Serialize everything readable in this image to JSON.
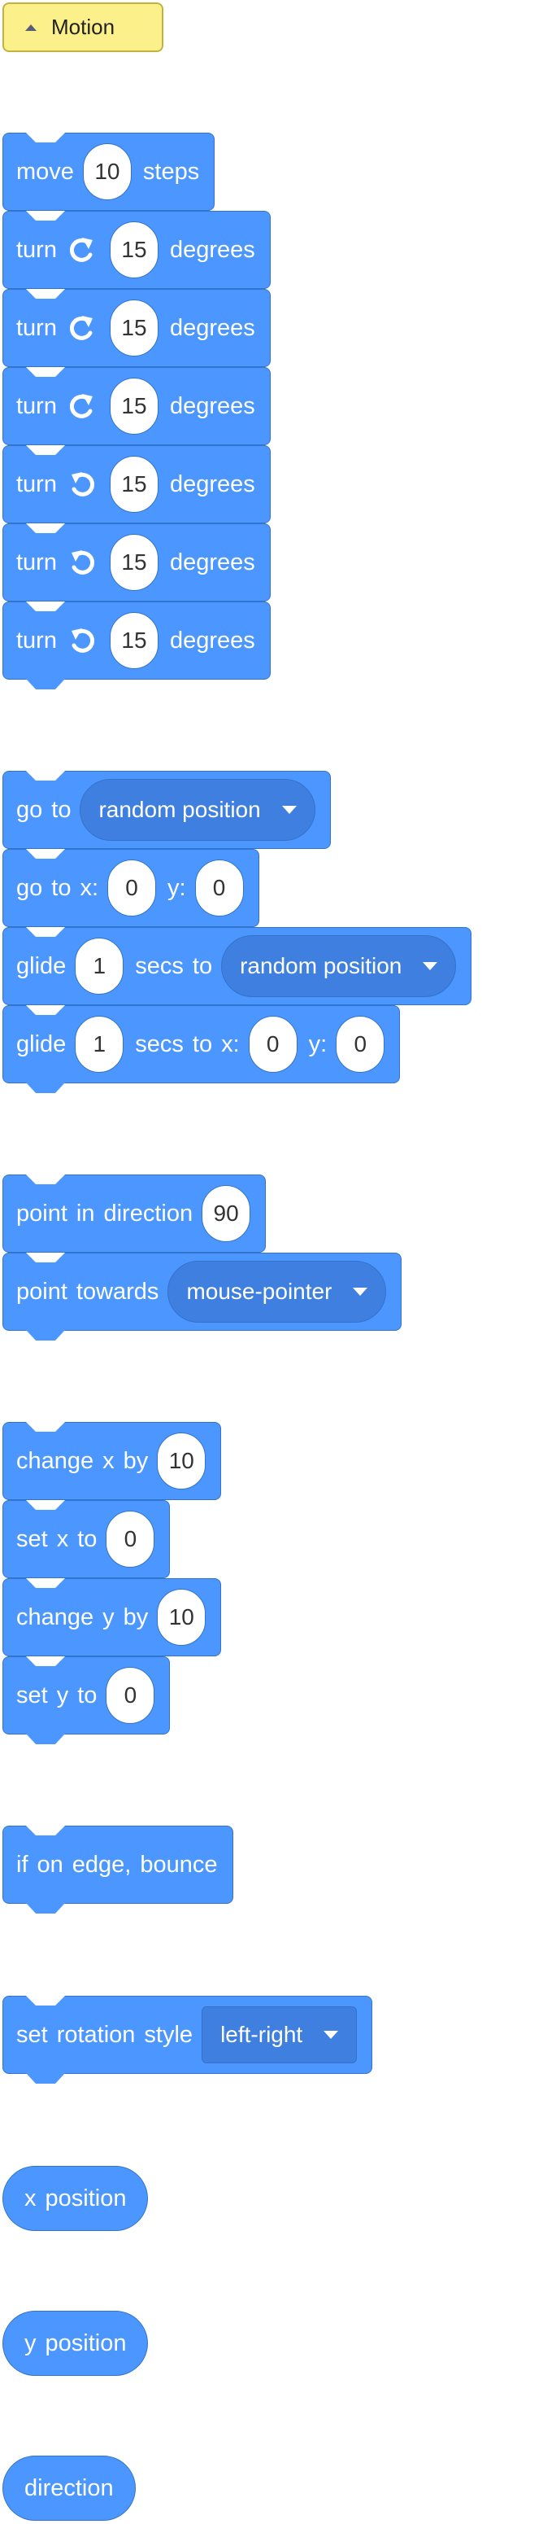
{
  "category": {
    "label": "Motion"
  },
  "blocks": {
    "move": {
      "w1": "move",
      "steps": "10",
      "w2": "steps"
    },
    "turn_cw_1": {
      "w1": "turn",
      "degrees": "15",
      "w2": "degrees"
    },
    "turn_cw_2": {
      "w1": "turn",
      "degrees": "15",
      "w2": "degrees"
    },
    "turn_cw_3": {
      "w1": "turn",
      "degrees": "15",
      "w2": "degrees"
    },
    "turn_ccw_1": {
      "w1": "turn",
      "degrees": "15",
      "w2": "degrees"
    },
    "turn_ccw_2": {
      "w1": "turn",
      "degrees": "15",
      "w2": "degrees"
    },
    "turn_ccw_3": {
      "w1": "turn",
      "degrees": "15",
      "w2": "degrees"
    },
    "goto": {
      "w1": "go",
      "w2": "to",
      "target": "random position"
    },
    "goto_xy": {
      "w1": "go",
      "w2": "to",
      "w3": "x:",
      "x": "0",
      "w4": "y:",
      "y": "0"
    },
    "glide_to": {
      "w1": "glide",
      "secs": "1",
      "w2": "secs",
      "w3": "to",
      "target": "random position"
    },
    "glide_xy": {
      "w1": "glide",
      "secs": "1",
      "w2": "secs",
      "w3": "to",
      "w4": "x:",
      "x": "0",
      "w5": "y:",
      "y": "0"
    },
    "point_dir": {
      "w1": "point",
      "w2": "in",
      "w3": "direction",
      "dir": "90"
    },
    "point_towards": {
      "w1": "point",
      "w2": "towards",
      "target": "mouse-pointer"
    },
    "change_x": {
      "w1": "change",
      "w2": "x",
      "w3": "by",
      "value": "10"
    },
    "set_x": {
      "w1": "set",
      "w2": "x",
      "w3": "to",
      "value": "0"
    },
    "change_y": {
      "w1": "change",
      "w2": "y",
      "w3": "by",
      "value": "10"
    },
    "set_y": {
      "w1": "set",
      "w2": "y",
      "w3": "to",
      "value": "0"
    },
    "bounce": {
      "w1": "if",
      "w2": "on",
      "w3": "edge,",
      "w4": "bounce"
    },
    "rotation_style": {
      "w1": "set",
      "w2": "rotation",
      "w3": "style",
      "style": "left-right"
    },
    "x_position": {
      "w1": "x",
      "w2": "position"
    },
    "y_position": {
      "w1": "y",
      "w2": "position"
    },
    "direction": {
      "w1": "direction"
    }
  },
  "colors": {
    "block": "#4c97ff",
    "block_border": "#3373cc",
    "menu_field": "#3f7fe0",
    "category": "#fcf08a"
  },
  "icons": {
    "turn_right": "rotate-right-icon",
    "turn_left": "rotate-left-icon",
    "dropdown": "triangle-down-icon",
    "category_caret": "caret-up-icon"
  }
}
